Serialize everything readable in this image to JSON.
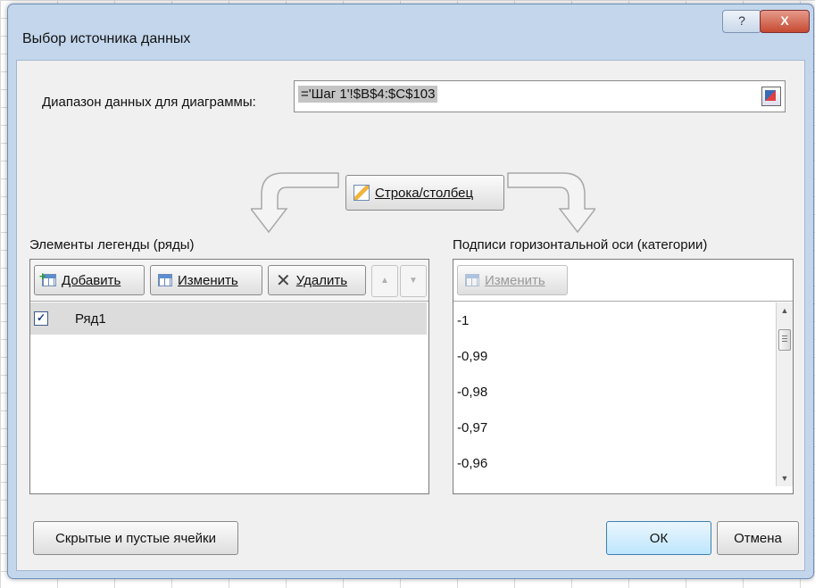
{
  "dialog": {
    "title": "Выбор источника данных",
    "help_glyph": "?",
    "close_glyph": "X"
  },
  "range": {
    "label": "Диапазон данных для диаграммы:",
    "value": "='Шаг 1'!$B$4:$C$103"
  },
  "switch_button": {
    "label": "Строка/столбец"
  },
  "legend": {
    "label": "Элементы легенды (ряды)",
    "add_label": "Добавить",
    "edit_label": "Изменить",
    "remove_label": "Удалить",
    "up_glyph": "▲",
    "down_glyph": "▼",
    "series": [
      {
        "name": "Ряд1",
        "checked": true
      }
    ]
  },
  "categories": {
    "label": "Подписи горизонтальной оси (категории)",
    "edit_label": "Изменить",
    "items": [
      "-1",
      "-0,99",
      "-0,98",
      "-0,97",
      "-0,96"
    ]
  },
  "footer": {
    "hidden_cells_label": "Скрытые и пустые ячейки",
    "ok_label": "ОК",
    "cancel_label": "Отмена"
  },
  "colors": {
    "frame": "#c3d6ec",
    "close_button": "#c64a33",
    "selected_row": "#dcdcdc"
  }
}
